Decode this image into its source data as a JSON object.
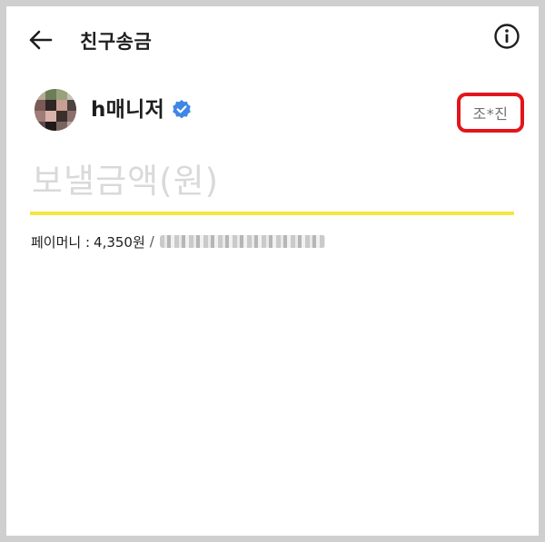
{
  "header": {
    "title": "친구송금",
    "back_icon": "arrow-left-icon",
    "info_icon": "info-circle-icon"
  },
  "recipient": {
    "nickname": "h매니저",
    "verified_icon": "verified-badge-icon",
    "real_name": "조*진",
    "highlight_color": "#e3151b"
  },
  "amount": {
    "value": "",
    "placeholder": "보낼금액(원)",
    "underline_color": "#f6e53e"
  },
  "balance": {
    "label": "페이머니 :",
    "amount": "4,350원",
    "separator": "/"
  }
}
